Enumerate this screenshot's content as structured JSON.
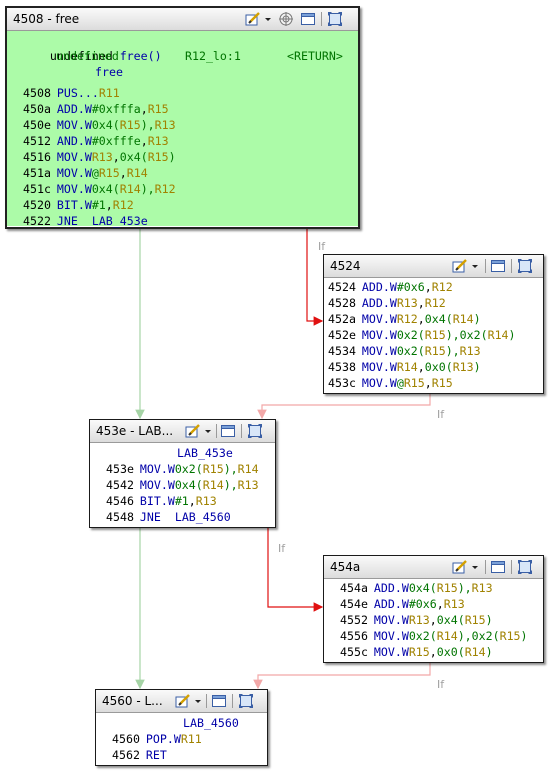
{
  "nodes": {
    "n4508": {
      "title": "4508 - free",
      "signature_kw": "undefined",
      "signature_fn": "free()",
      "params": {
        "ret_type": "undefined",
        "storage": "R12_lo:1",
        "ret": "<RETURN>"
      },
      "func_label": "free",
      "rows": [
        {
          "addr": "4508",
          "mn": "PUS...",
          "op": [
            [
              "R11",
              "rg"
            ]
          ]
        },
        {
          "addr": "450a",
          "mn": "ADD.W",
          "op": [
            [
              "#0xfffa",
              "sc"
            ],
            [
              ",",
              ""
            ],
            [
              "R15",
              "rg"
            ]
          ]
        },
        {
          "addr": "450e",
          "mn": "MOV.W",
          "op": [
            [
              "0x4(",
              "sc"
            ],
            [
              "R15",
              "rg"
            ],
            [
              "),",
              "sc"
            ],
            [
              "R13",
              "rg"
            ]
          ]
        },
        {
          "addr": "4512",
          "mn": "AND.W",
          "op": [
            [
              "#0xfffe",
              "sc"
            ],
            [
              ",",
              ""
            ],
            [
              "R13",
              "rg"
            ]
          ]
        },
        {
          "addr": "4516",
          "mn": "MOV.W",
          "op": [
            [
              "R13",
              "rg"
            ],
            [
              ",",
              ""
            ],
            [
              "0x4(",
              "sc"
            ],
            [
              "R15",
              "rg"
            ],
            [
              ")",
              "sc"
            ]
          ]
        },
        {
          "addr": "451a",
          "mn": "MOV.W",
          "op": [
            [
              "@",
              "sc"
            ],
            [
              "R15",
              "rg"
            ],
            [
              ",",
              ""
            ],
            [
              "R14",
              "rg"
            ]
          ]
        },
        {
          "addr": "451c",
          "mn": "MOV.W",
          "op": [
            [
              "0x4(",
              "sc"
            ],
            [
              "R14",
              "rg"
            ],
            [
              "),",
              "sc"
            ],
            [
              "R12",
              "rg"
            ]
          ]
        },
        {
          "addr": "4520",
          "mn": "BIT.W",
          "op": [
            [
              "#1",
              "sc"
            ],
            [
              ",",
              ""
            ],
            [
              "R12",
              "rg"
            ]
          ]
        },
        {
          "addr": "4522",
          "mn": "JNE",
          "op": [
            [
              "LAB_453e",
              "lb"
            ]
          ]
        }
      ]
    },
    "n4524": {
      "title": "4524",
      "rows": [
        {
          "addr": "4524",
          "mn": "ADD.W",
          "op": [
            [
              "#0x6",
              "sc"
            ],
            [
              ",",
              ""
            ],
            [
              "R12",
              "rg"
            ]
          ]
        },
        {
          "addr": "4528",
          "mn": "ADD.W",
          "op": [
            [
              "R13",
              "rg"
            ],
            [
              ",",
              ""
            ],
            [
              "R12",
              "rg"
            ]
          ]
        },
        {
          "addr": "452a",
          "mn": "MOV.W",
          "op": [
            [
              "R12",
              "rg"
            ],
            [
              ",",
              ""
            ],
            [
              "0x4(",
              "sc"
            ],
            [
              "R14",
              "rg"
            ],
            [
              ")",
              "sc"
            ]
          ]
        },
        {
          "addr": "452e",
          "mn": "MOV.W",
          "op": [
            [
              "0x2(",
              "sc"
            ],
            [
              "R15",
              "rg"
            ],
            [
              "),",
              "sc"
            ],
            [
              "0x2(",
              "sc"
            ],
            [
              "R14",
              "rg"
            ],
            [
              ")",
              "sc"
            ]
          ]
        },
        {
          "addr": "4534",
          "mn": "MOV.W",
          "op": [
            [
              "0x2(",
              "sc"
            ],
            [
              "R15",
              "rg"
            ],
            [
              "),",
              "sc"
            ],
            [
              "R13",
              "rg"
            ]
          ]
        },
        {
          "addr": "4538",
          "mn": "MOV.W",
          "op": [
            [
              "R14",
              "rg"
            ],
            [
              ",",
              ""
            ],
            [
              "0x0(",
              "sc"
            ],
            [
              "R13",
              "rg"
            ],
            [
              ")",
              "sc"
            ]
          ]
        },
        {
          "addr": "453c",
          "mn": "MOV.W",
          "op": [
            [
              "@",
              "sc"
            ],
            [
              "R15",
              "rg"
            ],
            [
              ",",
              ""
            ],
            [
              "R15",
              "rg"
            ]
          ]
        }
      ]
    },
    "n453e": {
      "title": "453e - LAB...",
      "label": "LAB_453e",
      "rows": [
        {
          "addr": "453e",
          "mn": "MOV.W",
          "op": [
            [
              "0x2(",
              "sc"
            ],
            [
              "R15",
              "rg"
            ],
            [
              "),",
              "sc"
            ],
            [
              "R14",
              "rg"
            ]
          ]
        },
        {
          "addr": "4542",
          "mn": "MOV.W",
          "op": [
            [
              "0x4(",
              "sc"
            ],
            [
              "R14",
              "rg"
            ],
            [
              "),",
              "sc"
            ],
            [
              "R13",
              "rg"
            ]
          ]
        },
        {
          "addr": "4546",
          "mn": "BIT.W",
          "op": [
            [
              "#1",
              "sc"
            ],
            [
              ",",
              ""
            ],
            [
              "R13",
              "rg"
            ]
          ]
        },
        {
          "addr": "4548",
          "mn": "JNE",
          "op": [
            [
              "LAB_4560",
              "lb"
            ]
          ]
        }
      ]
    },
    "n454a": {
      "title": "454a",
      "rows": [
        {
          "addr": "454a",
          "mn": "ADD.W",
          "op": [
            [
              "0x4(",
              "sc"
            ],
            [
              "R15",
              "rg"
            ],
            [
              "),",
              "sc"
            ],
            [
              "R13",
              "rg"
            ]
          ]
        },
        {
          "addr": "454e",
          "mn": "ADD.W",
          "op": [
            [
              "#0x6",
              "sc"
            ],
            [
              ",",
              ""
            ],
            [
              "R13",
              "rg"
            ]
          ]
        },
        {
          "addr": "4552",
          "mn": "MOV.W",
          "op": [
            [
              "R13",
              "rg"
            ],
            [
              ",",
              ""
            ],
            [
              "0x4(",
              "sc"
            ],
            [
              "R15",
              "rg"
            ],
            [
              ")",
              "sc"
            ]
          ]
        },
        {
          "addr": "4556",
          "mn": "MOV.W",
          "op": [
            [
              "0x2(",
              "sc"
            ],
            [
              "R14",
              "rg"
            ],
            [
              "),",
              "sc"
            ],
            [
              "0x2(",
              "sc"
            ],
            [
              "R15",
              "rg"
            ],
            [
              ")",
              "sc"
            ]
          ]
        },
        {
          "addr": "455c",
          "mn": "MOV.W",
          "op": [
            [
              "R15",
              "rg"
            ],
            [
              ",",
              ""
            ],
            [
              "0x0(",
              "sc"
            ],
            [
              "R14",
              "rg"
            ],
            [
              ")",
              "sc"
            ]
          ]
        }
      ]
    },
    "n4560": {
      "title": "4560 - L...",
      "label": "LAB_4560",
      "rows": [
        {
          "addr": "4560",
          "mn": "POP.W",
          "op": [
            [
              "R11",
              "rg"
            ]
          ]
        },
        {
          "addr": "4562",
          "mn": "RET",
          "op": []
        }
      ]
    }
  },
  "edge_labels": {
    "e1": "If",
    "e2": "If",
    "e3": "If",
    "e4": "If"
  },
  "icons": {
    "edit": "edit-code-icon",
    "menu": "dropdown-arrow-icon",
    "decompile": "decompile-icon",
    "window": "window-icon",
    "full": "fullscreen-icon"
  },
  "colors": {
    "highlight_bg": "#acfba8",
    "edge_true": "#e01010",
    "edge_false": "#a6d4a6",
    "edge_fall": "#f2a8a8",
    "mnemonic": "#0000a8",
    "register": "#a08200",
    "scalar": "#007400"
  }
}
